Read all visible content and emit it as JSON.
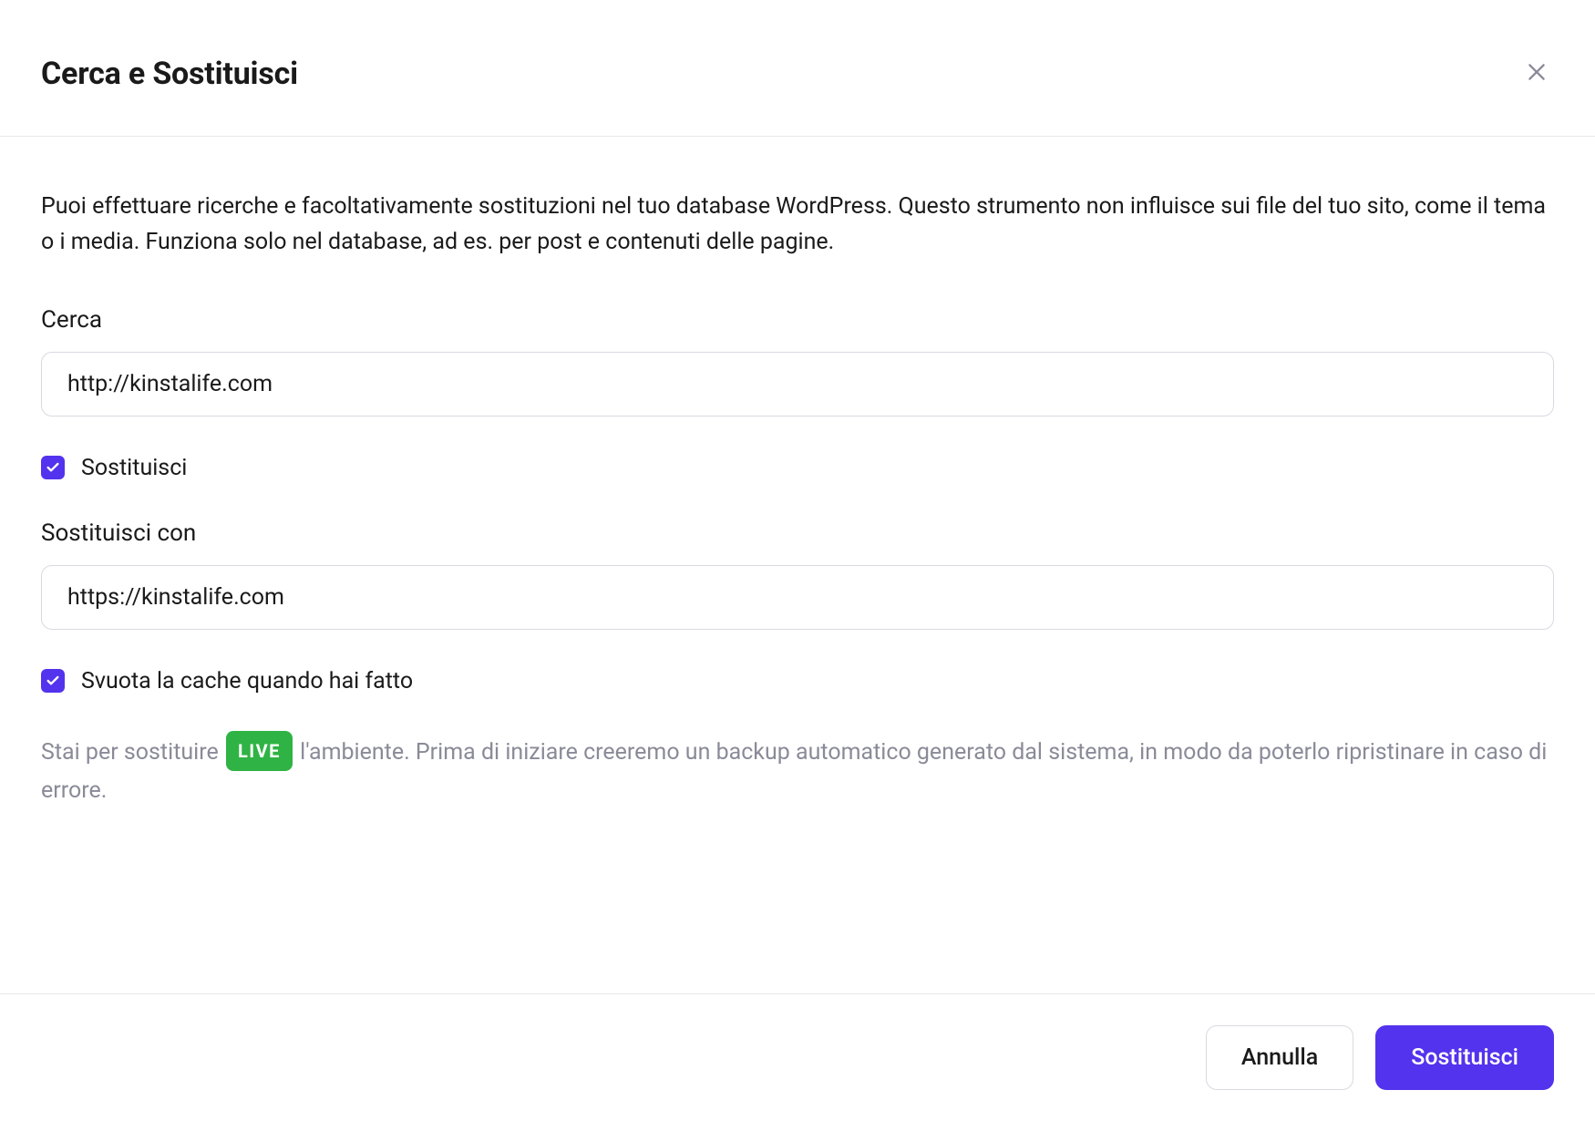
{
  "header": {
    "title": "Cerca e Sostituisci"
  },
  "body": {
    "description": "Puoi effettuare ricerche e facoltativamente sostituzioni nel tuo database WordPress. Questo strumento non influisce sui file del tuo sito, come il tema o i media. Funziona solo nel database, ad es. per post e contenuti delle pagine.",
    "search": {
      "label": "Cerca",
      "value": "http://kinstalife.com"
    },
    "replace_toggle": {
      "label": "Sostituisci",
      "checked": true
    },
    "replace_with": {
      "label": "Sostituisci con",
      "value": "https://kinstalife.com"
    },
    "clear_cache": {
      "label": "Svuota la cache quando hai fatto",
      "checked": true
    },
    "notice": {
      "before_badge": "Stai per sostituire ",
      "badge": "LIVE",
      "after_badge": " l'ambiente. Prima di iniziare creeremo un backup automatico generato dal sistema, in modo da poterlo ripristinare in caso di errore."
    }
  },
  "footer": {
    "cancel": "Annulla",
    "submit": "Sostituisci"
  }
}
